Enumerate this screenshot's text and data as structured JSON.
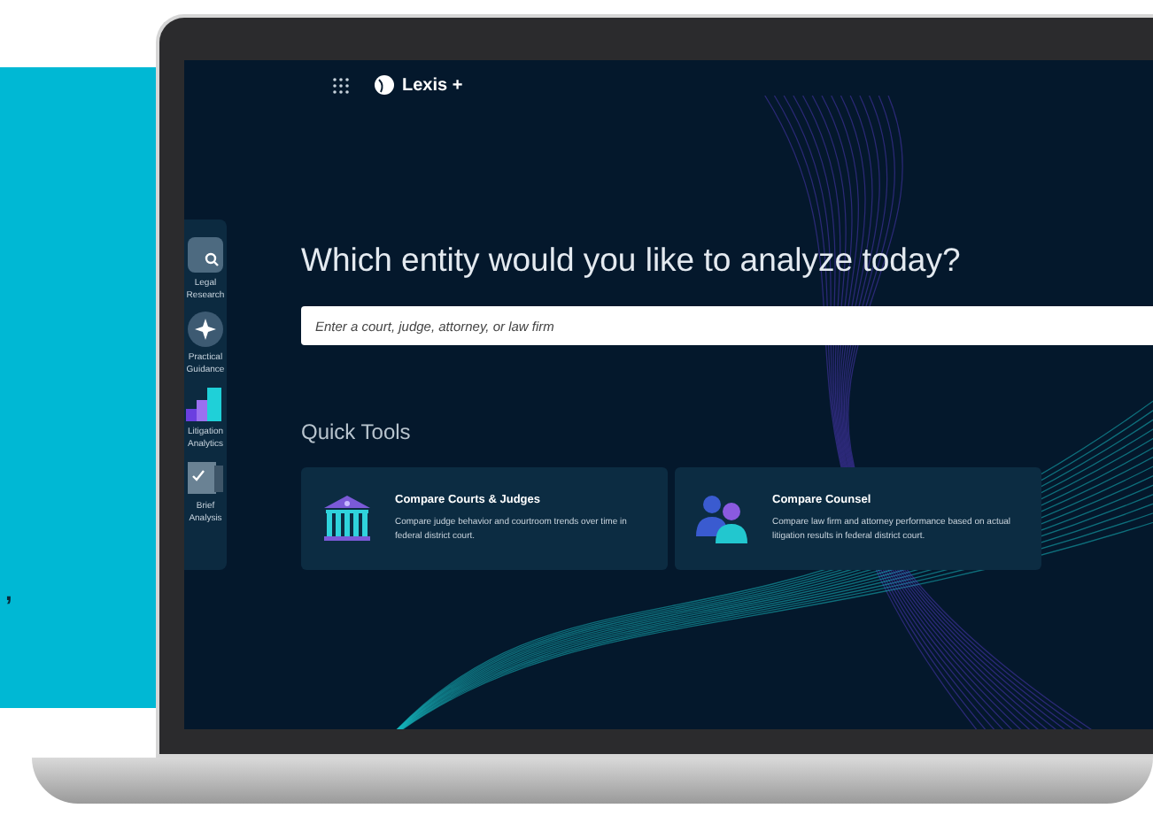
{
  "side_panel": {
    "text": ","
  },
  "app": {
    "logo": "Lexis +",
    "sidebar": {
      "items": [
        {
          "label": "Legal Research",
          "kind": "search"
        },
        {
          "label": "Practical Guidance",
          "kind": "compass"
        },
        {
          "label": "Litigation Analytics",
          "kind": "chart"
        },
        {
          "label": "Brief Analysis",
          "kind": "document"
        }
      ]
    },
    "headline": "Which entity would you like to analyze today?",
    "search": {
      "placeholder": "Enter a court, judge, attorney, or law firm"
    },
    "quick_tools": {
      "title": "Quick Tools",
      "cards": [
        {
          "kind": "court",
          "title": "Compare Courts & Judges",
          "description": "Compare judge behavior and courtroom trends over time in federal district court."
        },
        {
          "kind": "counsel",
          "title": "Compare Counsel",
          "description": "Compare law firm and attorney performance based on actual litigation results in federal district court."
        }
      ]
    }
  }
}
